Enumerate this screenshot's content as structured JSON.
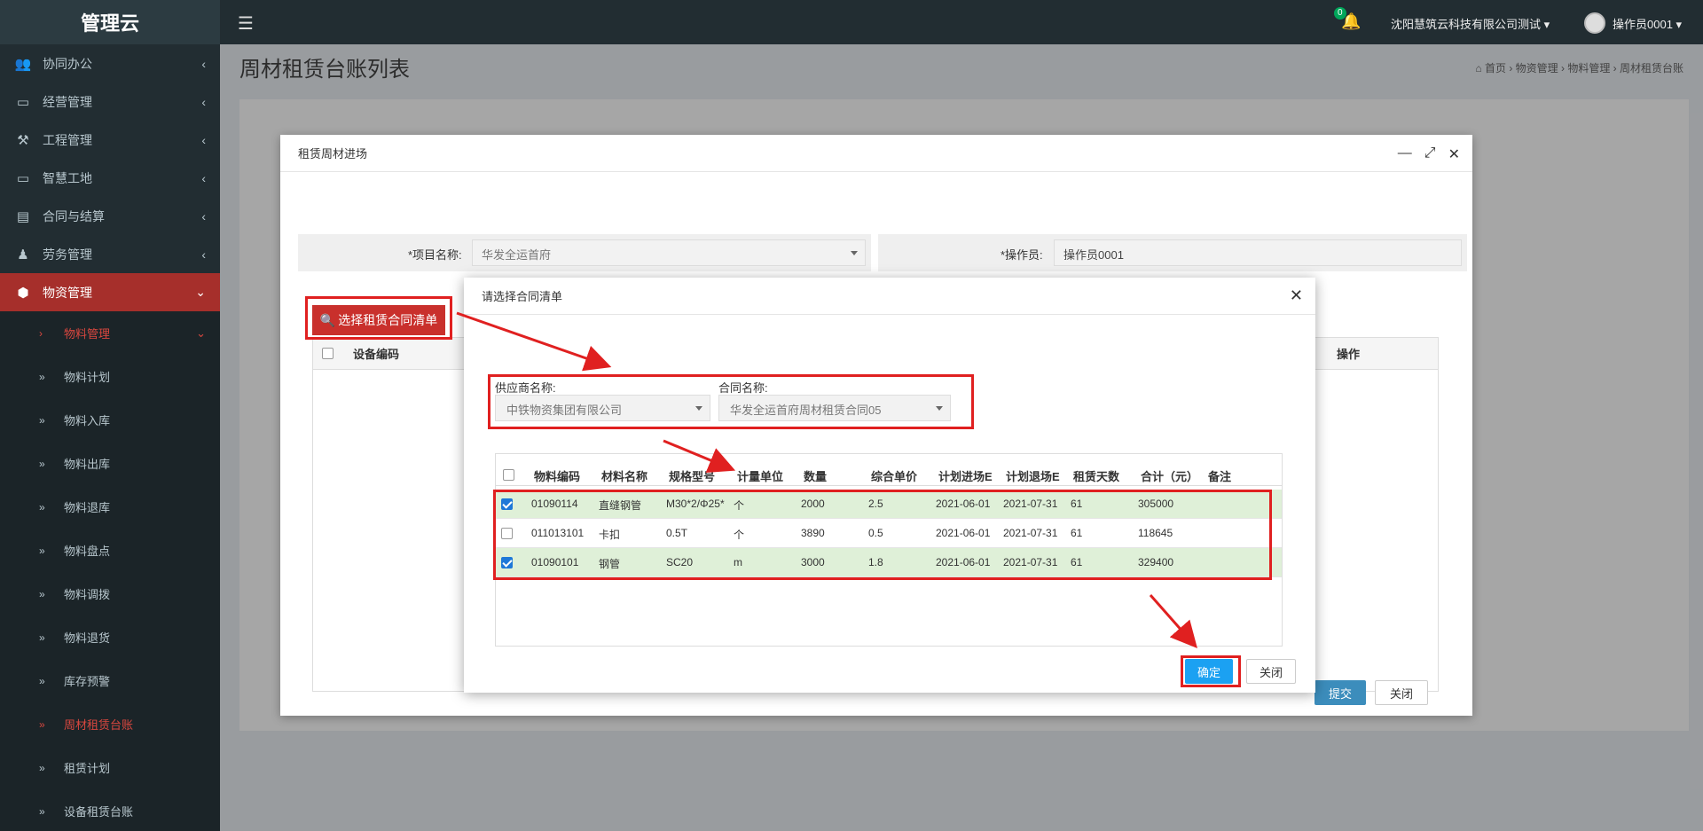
{
  "app": {
    "logo": "管理云"
  },
  "header": {
    "notify_count": "0",
    "company": "沈阳慧筑云科技有限公司测试 ▾",
    "operator": "操作员0001 ▾"
  },
  "sidebar": {
    "items": [
      {
        "label": "协同办公"
      },
      {
        "label": "经营管理"
      },
      {
        "label": "工程管理"
      },
      {
        "label": "智慧工地"
      },
      {
        "label": "合同与结算"
      },
      {
        "label": "劳务管理"
      },
      {
        "label": "物资管理"
      }
    ],
    "sub": [
      {
        "label": "物料管理"
      },
      {
        "label": "物料计划"
      },
      {
        "label": "物料入库"
      },
      {
        "label": "物料出库"
      },
      {
        "label": "物料退库"
      },
      {
        "label": "物料盘点"
      },
      {
        "label": "物料调拨"
      },
      {
        "label": "物料退货"
      },
      {
        "label": "库存预警"
      },
      {
        "label": "周材租赁台账"
      },
      {
        "label": "租赁计划"
      },
      {
        "label": "设备租赁台账"
      }
    ]
  },
  "page": {
    "title": "周材租赁台账列表",
    "breadcrumb": "⌂ 首页  ›  物资管理  ›  物料管理  ›  周材租赁台账"
  },
  "modal1": {
    "title": "租赁周材进场",
    "project_label": "*项目名称:",
    "project_value": "华发全运首府",
    "operator_label": "*操作员:",
    "operator_value": "操作员0001",
    "choose_btn": "选择租赁合同清单",
    "col_code": "设备编码",
    "col_op": "操作",
    "submit": "提交",
    "close": "关闭"
  },
  "modal2": {
    "title": "请选择合同清单",
    "supplier_label": "供应商名称:",
    "supplier_value": "中铁物资集团有限公司",
    "contract_label": "合同名称:",
    "contract_value": "华发全运首府周材租赁合同05",
    "columns": [
      "物料编码",
      "材料名称",
      "规格型号",
      "计量单位",
      "数量",
      "综合单价",
      "计划进场E",
      "计划退场E",
      "租赁天数",
      "合计（元）",
      "备注"
    ],
    "rows": [
      {
        "checked": true,
        "code": "01090114",
        "name": "直缝钢管",
        "spec": "M30*2/Φ25*",
        "unit": "个",
        "qty": "2000",
        "price": "2.5",
        "in": "2021-06-01",
        "out": "2021-07-31",
        "days": "61",
        "total": "305000"
      },
      {
        "checked": false,
        "code": "011013101",
        "name": "卡扣",
        "spec": "0.5T",
        "unit": "个",
        "qty": "3890",
        "price": "0.5",
        "in": "2021-06-01",
        "out": "2021-07-31",
        "days": "61",
        "total": "118645"
      },
      {
        "checked": true,
        "code": "01090101",
        "name": "钢管",
        "spec": "SC20",
        "unit": "m",
        "qty": "3000",
        "price": "1.8",
        "in": "2021-06-01",
        "out": "2021-07-31",
        "days": "61",
        "total": "329400"
      }
    ],
    "ok": "确定",
    "close": "关闭"
  },
  "colors": {
    "sidebar": "#222d32",
    "accent_red": "#c9302c",
    "blue": "#1ba1f2",
    "highlight_box": "#e02020"
  }
}
